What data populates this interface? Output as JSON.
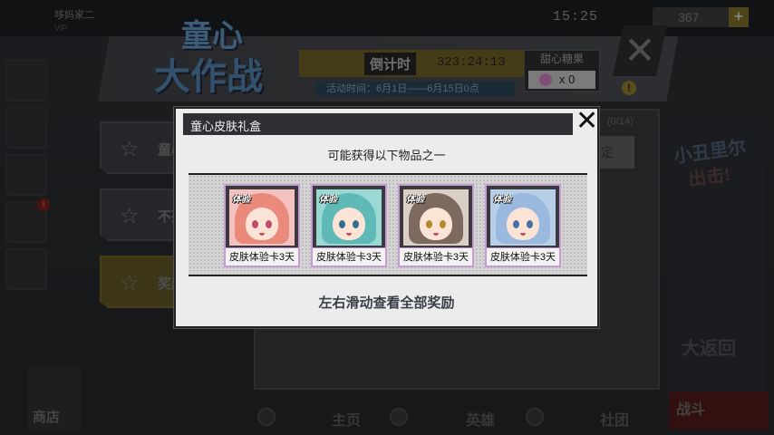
{
  "topbar": {
    "player_name": "哆妈家二",
    "player_sub": "VIP",
    "clock": "15:25",
    "currency_value": "367",
    "currency_plus": "+"
  },
  "event": {
    "logo_line1": "童心",
    "logo_line2": "大作战",
    "countdown_label": "倒计时",
    "countdown_value": "323:24:13",
    "event_time": "活动时间：6月1日——6月15日0点",
    "candy_title": "甜心糖果",
    "candy_count": "x 0",
    "warn_symbol": "!",
    "close_symbol": "✕"
  },
  "side_tabs": [
    {
      "label": "童心"
    },
    {
      "label": "不死"
    },
    {
      "label": "奖励"
    }
  ],
  "main_panel": {
    "progress": "(0/14)",
    "confirm_label": "定"
  },
  "right_art": {
    "line1": "小丑里尔",
    "line2": "出击!",
    "bottom_text": "大返回"
  },
  "bottom_nav": {
    "shop": "商店",
    "home": "主页",
    "heroes": "英雄",
    "guild": "社团",
    "battle": "战斗"
  },
  "modal": {
    "title": "童心皮肤礼盒",
    "close_symbol": "✕",
    "subtitle": "可能获得以下物品之一",
    "swipe_hint": "左右滑动查看全部奖励",
    "rewards": [
      {
        "tag": "体验",
        "label": "皮肤体验卡3天",
        "bg": "#f3c2c0",
        "hair": "#e98a7a",
        "eye": "#c24a6a"
      },
      {
        "tag": "体验",
        "label": "皮肤体验卡3天",
        "bg": "#9ad8d4",
        "hair": "#5fb9b6",
        "eye": "#2f6f8a"
      },
      {
        "tag": "体验",
        "label": "皮肤体验卡3天",
        "bg": "#d9cfc4",
        "hair": "#7d6a5e",
        "eye": "#b38a2a"
      },
      {
        "tag": "体验",
        "label": "皮肤体验卡3天",
        "bg": "#b8cfe8",
        "hair": "#9bb8de",
        "eye": "#4a6fa8"
      }
    ]
  }
}
